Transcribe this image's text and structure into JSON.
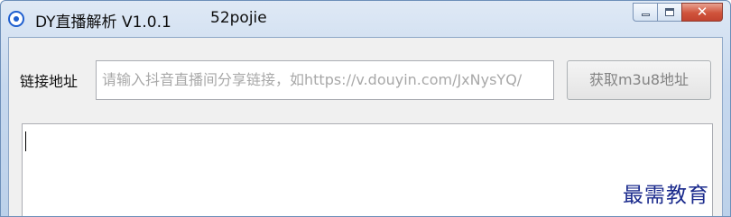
{
  "window": {
    "title": "DY直播解析 V1.0.1",
    "title_extra": "52pojie"
  },
  "form": {
    "url_label": "链接地址",
    "url_placeholder": "请输入抖音直播间分享链接，如https://v.douyin.com/JxNysYQ/",
    "get_button_label": "获取m3u8地址"
  },
  "output": {
    "value": ""
  },
  "watermark": "最需教育",
  "colors": {
    "accent": "#1f5fcf",
    "placeholder": "#a8a8a8",
    "watermark": "#1a2a8c",
    "close_button": "#d0533b"
  },
  "icons": {
    "app": "radio-app-icon",
    "minimize": "minimize-icon",
    "maximize": "maximize-icon",
    "close": "close-icon"
  }
}
